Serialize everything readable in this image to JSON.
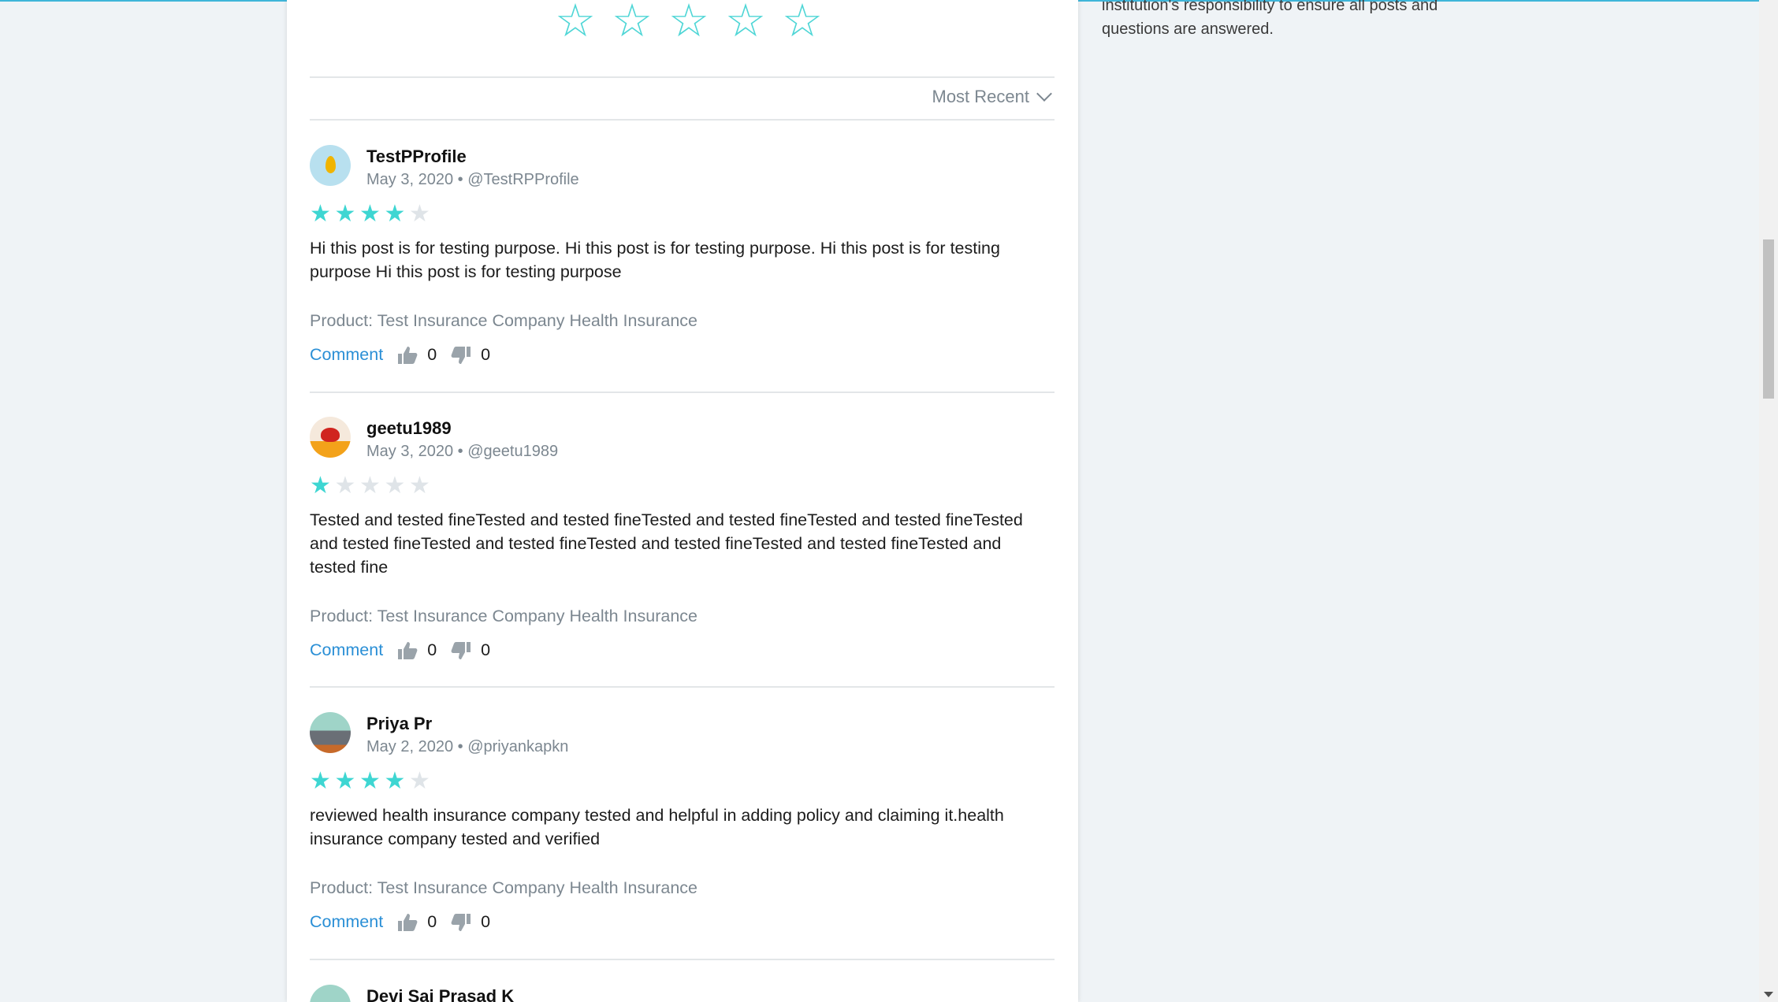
{
  "rating_widget": {
    "stars": [
      "☆",
      "☆",
      "☆",
      "☆",
      "☆"
    ]
  },
  "sort": {
    "label": "Most Recent"
  },
  "sidebar": {
    "note_line1": "institution's responsibility to ensure all posts and",
    "note_line2": "questions are answered."
  },
  "reviews": [
    {
      "name": "TestPProfile",
      "date": "May 3, 2020",
      "sep": "•",
      "handle": "@TestRPProfile",
      "rating": 4,
      "text": "Hi this post is for testing purpose. Hi this post is for testing purpose. Hi this post is for testing purpose Hi this post is for testing purpose",
      "product": "Product: Test Insurance Company Health Insurance",
      "comment_label": "Comment",
      "likes": "0",
      "dislikes": "0"
    },
    {
      "name": "geetu1989",
      "date": "May 3, 2020",
      "sep": "•",
      "handle": "@geetu1989",
      "rating": 1,
      "text": "Tested and tested fineTested and tested fineTested and tested fineTested and tested fineTested and tested fineTested and tested fineTested and tested fineTested and tested fineTested and tested fine",
      "product": "Product: Test Insurance Company Health Insurance",
      "comment_label": "Comment",
      "likes": "0",
      "dislikes": "0"
    },
    {
      "name": "Priya Pr",
      "date": "May 2, 2020",
      "sep": "•",
      "handle": "@priyankapkn",
      "rating": 4,
      "text": "reviewed health insurance company tested and helpful in adding policy and claiming it.health insurance company tested and verified",
      "product": "Product: Test Insurance Company Health Insurance",
      "comment_label": "Comment",
      "likes": "0",
      "dislikes": "0"
    },
    {
      "name": "Devi Sai Prasad K"
    }
  ],
  "colors": {
    "accent": "#2a8fd6",
    "star": "#3ed6d2",
    "muted": "#7c8790"
  }
}
